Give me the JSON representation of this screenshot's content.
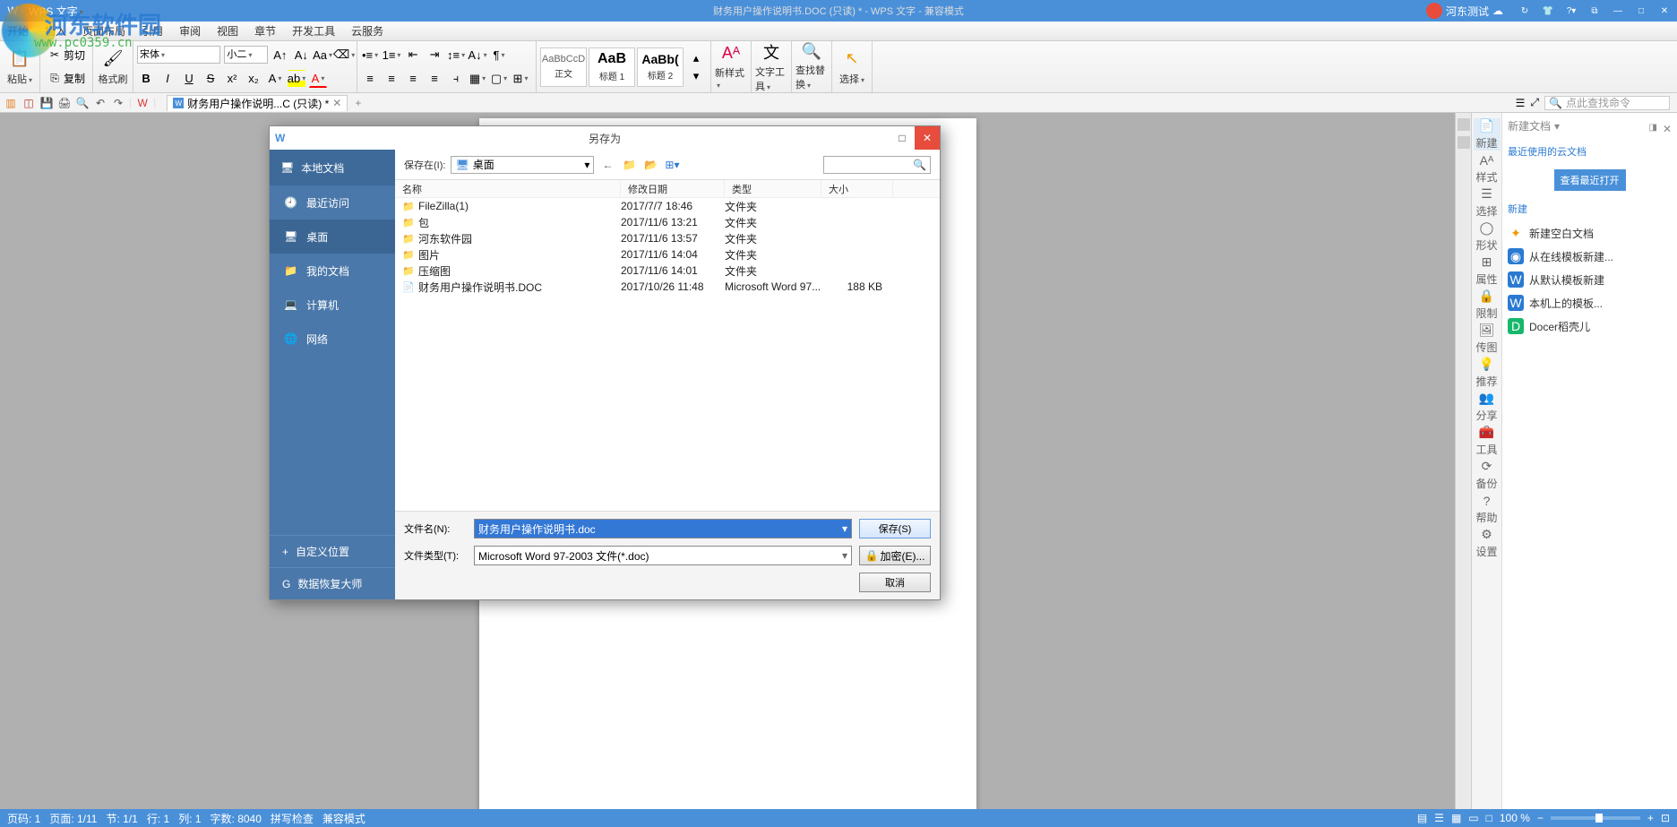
{
  "title_bar": {
    "app_name": "WPS 文字",
    "doc_title": "财务用户操作说明书.DOC (只读) * - WPS 文字 - 兼容模式",
    "user_name": "河东测试"
  },
  "watermark": {
    "text1": "河东软件园",
    "text2": "www.pc0359.cn"
  },
  "menu": [
    "开始",
    "插入",
    "页面布局",
    "引用",
    "审阅",
    "视图",
    "章节",
    "开发工具",
    "云服务"
  ],
  "ribbon": {
    "paste": "粘贴",
    "cut": "剪切",
    "copy": "复制",
    "format_painter": "格式刷",
    "font_name": "宋体",
    "font_size": "小二",
    "styles": [
      {
        "preview": "AaBbCcD",
        "name": "正文"
      },
      {
        "preview": "AaB",
        "name": "标题 1"
      },
      {
        "preview": "AaBb(",
        "name": "标题 2"
      }
    ],
    "new_style": "新样式",
    "text_tools": "文字工具",
    "find_replace": "查找替换",
    "select": "选择"
  },
  "tab_strip": {
    "tab_name": "财务用户操作说明...C (只读) *",
    "search_placeholder": "点此查找命令"
  },
  "task_pane": {
    "header": "新建文档",
    "recent_link": "最近使用的云文档",
    "view_recent_btn": "查看最近打开",
    "new_section": "新建",
    "icons": [
      "新建",
      "样式",
      "选择",
      "形状",
      "属性",
      "限制",
      "传图",
      "推荐",
      "分享",
      "工具",
      "备份",
      "帮助",
      "设置"
    ],
    "items": [
      {
        "icon": "✦",
        "label": "新建空白文档"
      },
      {
        "icon": "◉",
        "label": "从在线模板新建..."
      },
      {
        "icon": "W",
        "label": "从默认模板新建"
      },
      {
        "icon": "W",
        "label": "本机上的模板..."
      },
      {
        "icon": "D",
        "label": "Docer稻壳儿"
      }
    ]
  },
  "status": {
    "page": "页码: 1",
    "pages": "页面: 1/11",
    "section": "节: 1/1",
    "line": "行: 1",
    "col": "列: 1",
    "words": "字数: 8040",
    "spell": "拼写检查",
    "compat": "兼容模式",
    "zoom": "100 %"
  },
  "dialog": {
    "title": "另存为",
    "side_header": "本地文档",
    "side_items": [
      "最近访问",
      "桌面",
      "我的文档",
      "计算机",
      "网络"
    ],
    "side_active": 1,
    "custom_loc": "自定义位置",
    "recovery": "数据恢复大师",
    "save_in_lbl": "保存在(I):",
    "save_in_val": "桌面",
    "columns": {
      "name": "名称",
      "date": "修改日期",
      "type": "类型",
      "size": "大小"
    },
    "files": [
      {
        "icon": "📁",
        "name": "FileZilla(1)",
        "date": "2017/7/7 18:46",
        "type": "文件夹",
        "size": ""
      },
      {
        "icon": "📁",
        "name": "包",
        "date": "2017/11/6 13:21",
        "type": "文件夹",
        "size": ""
      },
      {
        "icon": "📁",
        "name": "河东软件园",
        "date": "2017/11/6 13:57",
        "type": "文件夹",
        "size": ""
      },
      {
        "icon": "📁",
        "name": "图片",
        "date": "2017/11/6 14:04",
        "type": "文件夹",
        "size": ""
      },
      {
        "icon": "📁",
        "name": "压缩图",
        "date": "2017/11/6 14:01",
        "type": "文件夹",
        "size": ""
      },
      {
        "icon": "📄",
        "name": "财务用户操作说明书.DOC",
        "date": "2017/10/26 11:48",
        "type": "Microsoft Word 97...",
        "size": "188 KB"
      }
    ],
    "filename_lbl": "文件名(N):",
    "filename_val": "财务用户操作说明书.doc",
    "filetype_lbl": "文件类型(T):",
    "filetype_val": "Microsoft Word 97-2003 文件(*.doc)",
    "save_btn": "保存(S)",
    "encrypt_btn": "加密(E)...",
    "cancel_btn": "取消"
  }
}
